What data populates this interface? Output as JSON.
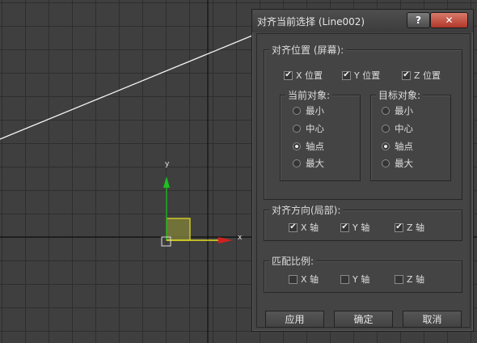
{
  "dialog": {
    "title": "对齐当前选择 (Line002)",
    "help_label": "?",
    "close_label": "✕"
  },
  "viewport": {
    "gizmo_x_label": "x",
    "gizmo_y_label": "y",
    "axis_colors": {
      "x": "#d02020",
      "y": "#20b020",
      "plane": "#e8e020"
    }
  },
  "align_position": {
    "legend": "对齐位置 (屏幕):",
    "checks": [
      {
        "label": "X 位置",
        "checked": true
      },
      {
        "label": "Y 位置",
        "checked": true
      },
      {
        "label": "Z 位置",
        "checked": true
      }
    ],
    "current_object": {
      "legend": "当前对象:",
      "options": [
        "最小",
        "中心",
        "轴点",
        "最大"
      ],
      "selected": "轴点"
    },
    "target_object": {
      "legend": "目标对象:",
      "options": [
        "最小",
        "中心",
        "轴点",
        "最大"
      ],
      "selected": "轴点"
    }
  },
  "align_orientation": {
    "legend": "对齐方向(局部):",
    "checks": [
      {
        "label": "X 轴",
        "checked": true
      },
      {
        "label": "Y 轴",
        "checked": true
      },
      {
        "label": "Z 轴",
        "checked": true
      }
    ]
  },
  "match_scale": {
    "legend": "匹配比例:",
    "checks": [
      {
        "label": "X 轴",
        "checked": false
      },
      {
        "label": "Y 轴",
        "checked": false
      },
      {
        "label": "Z 轴",
        "checked": false
      }
    ]
  },
  "buttons": {
    "apply": "应用",
    "ok": "确定",
    "cancel": "取消"
  }
}
